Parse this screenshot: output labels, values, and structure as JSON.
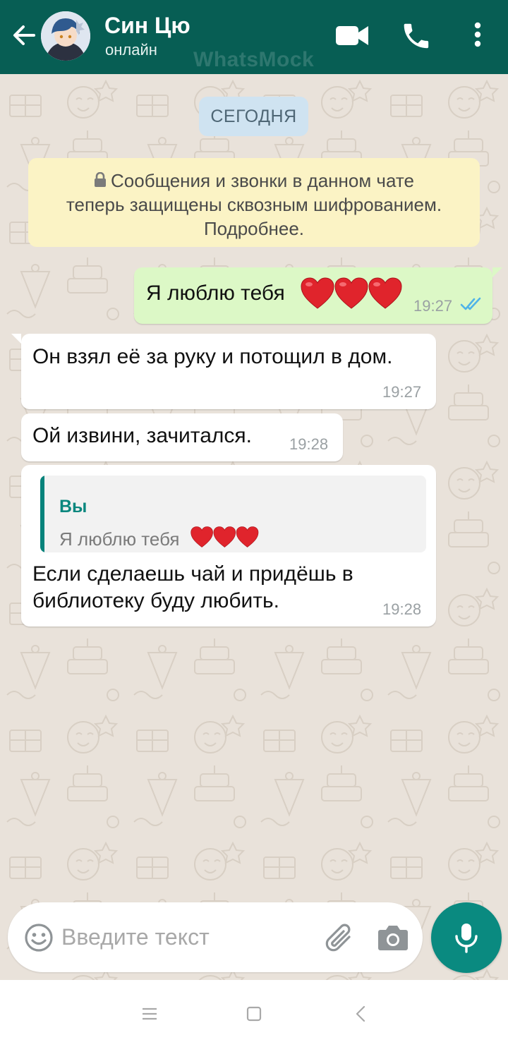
{
  "app": {
    "watermark": "WhatsMock"
  },
  "header": {
    "contact_name": "Син Цю",
    "status": "онлайн",
    "icons": [
      "back-arrow-icon",
      "video-call-icon",
      "phone-icon",
      "more-vert-icon"
    ]
  },
  "chat": {
    "date_label": "СЕГОДНЯ",
    "encryption_notice": {
      "line1": "Сообщения и звонки в данном чате",
      "line2": "теперь защищены сквозным шифрованием.",
      "line3": "Подробнее."
    },
    "messages": [
      {
        "direction": "outgoing",
        "text": "Я люблю тебя",
        "emoji": "❤️❤️❤️",
        "time": "19:27",
        "status": "read"
      },
      {
        "direction": "incoming",
        "text": "Он взял её за руку и потощил в дом.",
        "time": "19:27"
      },
      {
        "direction": "incoming",
        "text": "Ой извини, зачитался.",
        "time": "19:28"
      },
      {
        "direction": "incoming",
        "reply_to": {
          "author": "Вы",
          "text": "Я люблю тебя",
          "emoji": "❤️❤️❤️"
        },
        "line1": "Если сделаешь чай и придёшь в",
        "line2": "библиотеку буду любить.",
        "time": "19:28"
      }
    ]
  },
  "composer": {
    "placeholder": "Введите текст",
    "value": "",
    "icons": [
      "emoji-icon",
      "attach-icon",
      "camera-icon",
      "mic-icon"
    ]
  },
  "colors": {
    "header": "#075e54",
    "outgoing_bubble": "#dcf8c6",
    "incoming_bubble": "#ffffff",
    "notice": "#fbf3c5",
    "date_chip": "#cfe3f1",
    "accent": "#0a8a80",
    "read_ticks": "#4fb3e8"
  }
}
